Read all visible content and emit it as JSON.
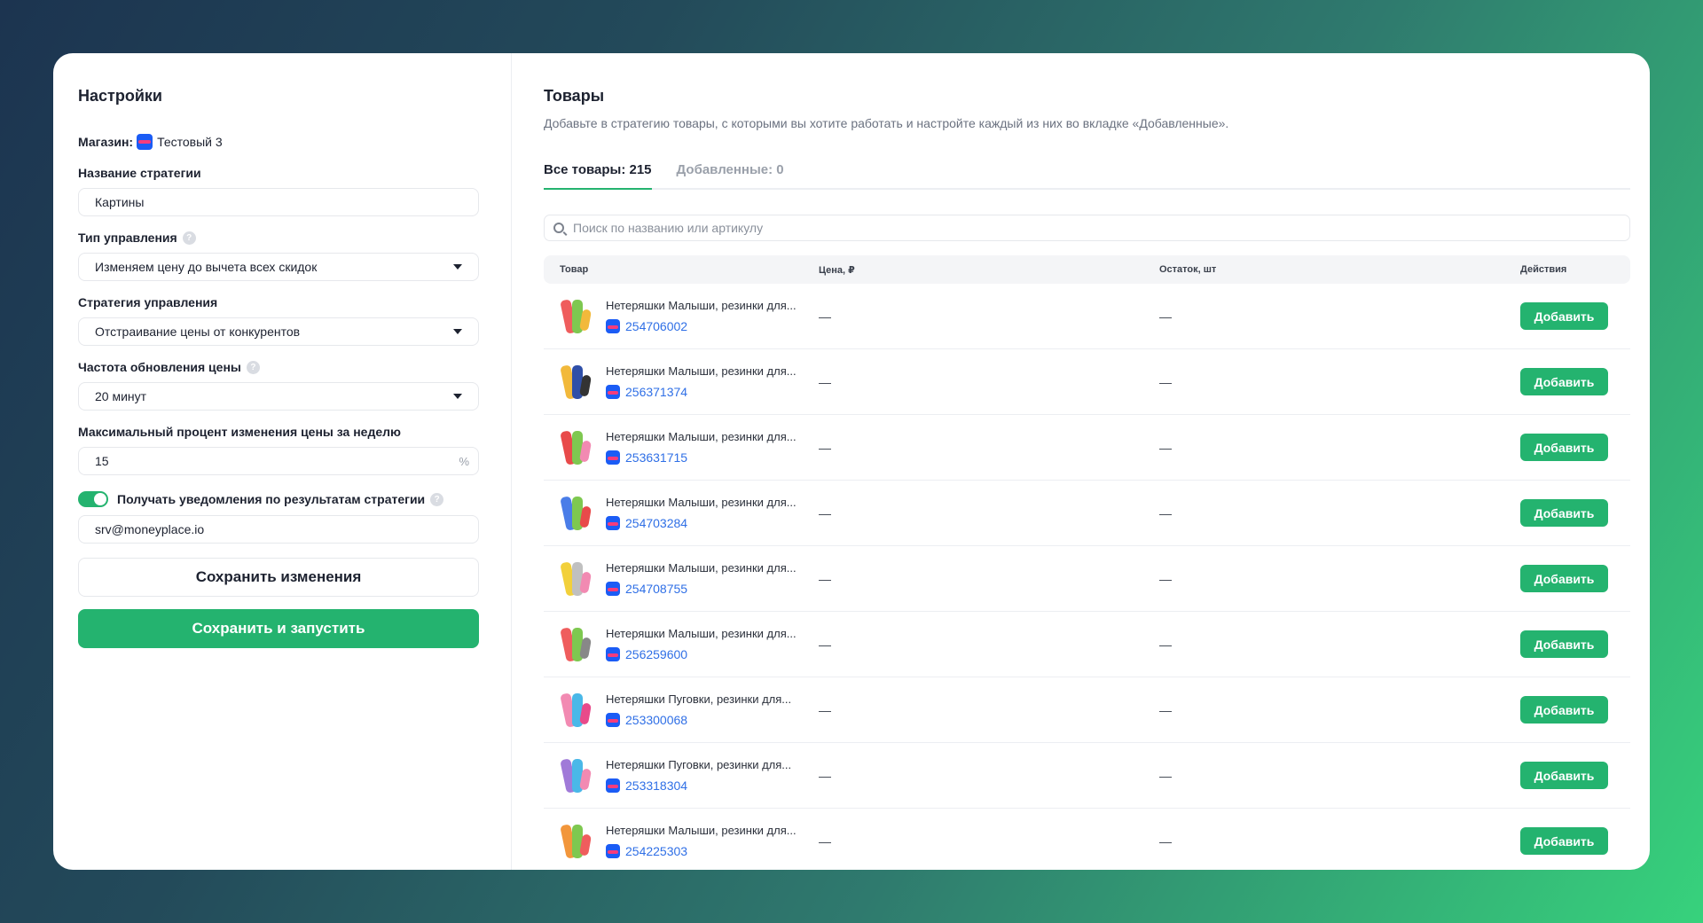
{
  "settings": {
    "title": "Настройки",
    "store_label": "Магазин:",
    "store_name": "Тестовый 3",
    "strategy_name_label": "Название стратегии",
    "strategy_name_value": "Картины",
    "control_type_label": "Тип управления",
    "control_type_value": "Изменяем цену до вычета всех скидок",
    "control_strategy_label": "Стратегия управления",
    "control_strategy_value": "Отстраивание цены от конкурентов",
    "update_freq_label": "Частота обновления цены",
    "update_freq_value": "20 минут",
    "max_change_label": "Максимальный процент изменения цены за неделю",
    "max_change_value": "15",
    "max_change_unit": "%",
    "notify_label": "Получать уведомления по результатам стратегии",
    "notify_enabled": true,
    "notify_email": "srv@moneyplace.io",
    "save_label": "Сохранить изменения",
    "save_run_label": "Сохранить и запустить",
    "help_glyph": "?"
  },
  "products": {
    "title": "Товары",
    "description": "Добавьте в стратегию товары, с которыми вы хотите работать и настройте каждый из них во вкладке «Добавленные».",
    "tabs": [
      {
        "label": "Все товары: 215",
        "active": true
      },
      {
        "label": "Добавленные: 0",
        "active": false
      }
    ],
    "search_placeholder": "Поиск по названию или артикулу",
    "columns": {
      "product": "Товар",
      "price": "Цена, ₽",
      "stock": "Остаток, шт",
      "actions": "Действия"
    },
    "rows": [
      {
        "name": "Нетеряшки Малыши, резинки для...",
        "sku": "254706002",
        "price": "—",
        "stock": "—",
        "action": "Добавить",
        "colors": [
          "#ef5d5d",
          "#7ec850",
          "#f2b93b"
        ]
      },
      {
        "name": "Нетеряшки Малыши, резинки для...",
        "sku": "256371374",
        "price": "—",
        "stock": "—",
        "action": "Добавить",
        "colors": [
          "#f2b93b",
          "#2f4fa8",
          "#333333"
        ]
      },
      {
        "name": "Нетеряшки Малыши, резинки для...",
        "sku": "253631715",
        "price": "—",
        "stock": "—",
        "action": "Добавить",
        "colors": [
          "#e84a4a",
          "#7ec850",
          "#f28ab2"
        ]
      },
      {
        "name": "Нетеряшки Малыши, резинки для...",
        "sku": "254703284",
        "price": "—",
        "stock": "—",
        "action": "Добавить",
        "colors": [
          "#4a7de8",
          "#7ec850",
          "#e84a4a"
        ]
      },
      {
        "name": "Нетеряшки Малыши, резинки для...",
        "sku": "254708755",
        "price": "—",
        "stock": "—",
        "action": "Добавить",
        "colors": [
          "#f2d03b",
          "#c0c0c0",
          "#f28ab2"
        ]
      },
      {
        "name": "Нетеряшки Малыши, резинки для...",
        "sku": "256259600",
        "price": "—",
        "stock": "—",
        "action": "Добавить",
        "colors": [
          "#ef5d5d",
          "#7ec850",
          "#888888"
        ]
      },
      {
        "name": "Нетеряшки Пуговки, резинки для...",
        "sku": "253300068",
        "price": "—",
        "stock": "—",
        "action": "Добавить",
        "colors": [
          "#f28ab2",
          "#4ab8e8",
          "#e84a8a"
        ]
      },
      {
        "name": "Нетеряшки Пуговки, резинки для...",
        "sku": "253318304",
        "price": "—",
        "stock": "—",
        "action": "Добавить",
        "colors": [
          "#a07ad8",
          "#4ab8e8",
          "#f28ab2"
        ]
      },
      {
        "name": "Нетеряшки Малыши, резинки для...",
        "sku": "254225303",
        "price": "—",
        "stock": "—",
        "action": "Добавить",
        "colors": [
          "#f2963b",
          "#7ec850",
          "#ef5d5d"
        ]
      }
    ]
  },
  "colors": {
    "accent": "#24b36f",
    "link": "#2f6fe6",
    "ozon_blue": "#1b5cf5"
  }
}
